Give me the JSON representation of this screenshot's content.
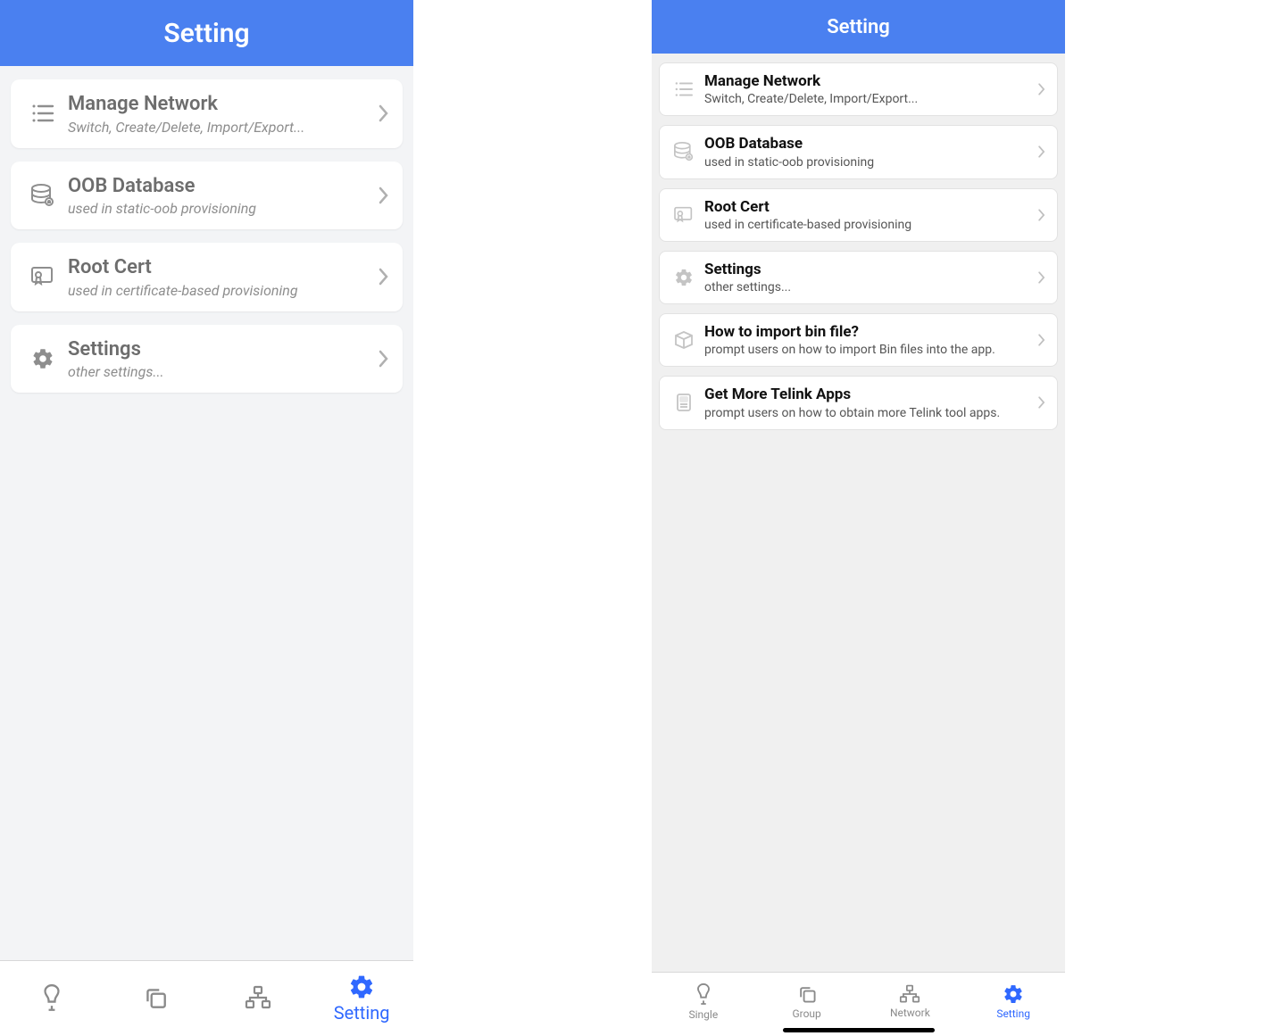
{
  "left": {
    "header_title": "Setting",
    "items": [
      {
        "icon": "list",
        "title": "Manage Network",
        "subtitle": "Switch, Create/Delete, Import/Export..."
      },
      {
        "icon": "db",
        "title": "OOB Database",
        "subtitle": "used in static-oob provisioning"
      },
      {
        "icon": "cert",
        "title": "Root Cert",
        "subtitle": "used in certificate-based provisioning"
      },
      {
        "icon": "gear",
        "title": "Settings",
        "subtitle": "other settings..."
      }
    ],
    "tabs": {
      "active_index": 3,
      "items": [
        {
          "icon": "bulb",
          "label": ""
        },
        {
          "icon": "stack",
          "label": ""
        },
        {
          "icon": "network",
          "label": ""
        },
        {
          "icon": "gear",
          "label": "Setting"
        }
      ]
    }
  },
  "right": {
    "header_title": "Setting",
    "items": [
      {
        "icon": "list",
        "title": "Manage Network",
        "subtitle": "Switch, Create/Delete, Import/Export..."
      },
      {
        "icon": "db",
        "title": "OOB Database",
        "subtitle": "used in static-oob provisioning"
      },
      {
        "icon": "cert",
        "title": "Root Cert",
        "subtitle": "used in certificate-based provisioning"
      },
      {
        "icon": "gear",
        "title": "Settings",
        "subtitle": "other settings..."
      },
      {
        "icon": "box",
        "title": "How to import bin file?",
        "subtitle": "prompt users on how to import Bin files into the app."
      },
      {
        "icon": "app",
        "title": "Get More Telink Apps",
        "subtitle": "prompt users on how to obtain more Telink tool apps."
      }
    ],
    "tabs": {
      "active_index": 3,
      "items": [
        {
          "icon": "bulb",
          "label": "Single"
        },
        {
          "icon": "stack",
          "label": "Group"
        },
        {
          "icon": "network",
          "label": "Network"
        },
        {
          "icon": "gear",
          "label": "Setting"
        }
      ]
    }
  }
}
